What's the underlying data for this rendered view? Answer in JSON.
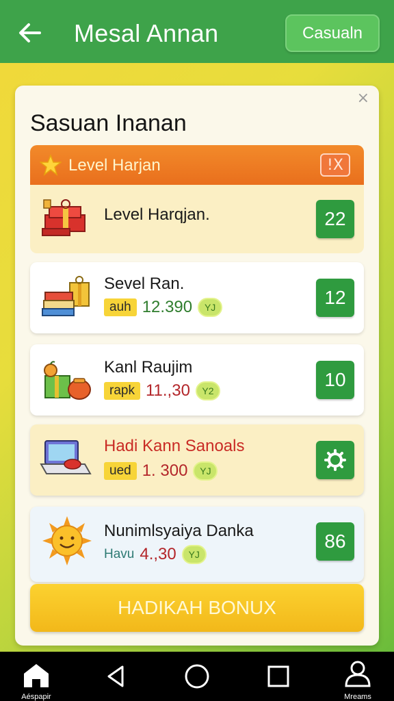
{
  "topbar": {
    "title": "Mesal Annan",
    "action_label": "Casualn"
  },
  "card": {
    "title": "Sasuan Inanan",
    "close_glyph": "×"
  },
  "section": {
    "label": "Level Harjan",
    "close_glyph": "!X"
  },
  "items": [
    {
      "name": "Level Harqjan.",
      "badge": "22",
      "icon": "gift-box-icon"
    },
    {
      "name": "Sevel Ran.",
      "tag": "auh",
      "amount": "12.390",
      "coin": "YJ",
      "badge": "12",
      "icon": "gift-stack-icon"
    },
    {
      "name": "Kanl Raujim",
      "tag": "rapk",
      "amount": "11.,30",
      "coin": "Y2",
      "badge": "10",
      "icon": "fruit-basket-icon"
    },
    {
      "name": "Hadi Kann Sanoals",
      "tag": "ued",
      "amount": "1. 300",
      "coin": "YJ",
      "badge_icon": "settings-icon",
      "icon": "laptop-icon"
    },
    {
      "name": "Nunimlsyaiya Danka",
      "tag": "Havu",
      "amount": "4.,30",
      "coin": "YJ",
      "badge": "86",
      "icon": "sun-icon"
    }
  ],
  "bonus_button": "HADIKAH BONUX",
  "navbar": {
    "home_label": "Aéspapir",
    "profile_label": "Mreams"
  },
  "colors": {
    "topbar": "#3ea34a",
    "section_header": "#ee7b23",
    "badge": "#2f9b3f",
    "bonus": "#f7c526"
  }
}
